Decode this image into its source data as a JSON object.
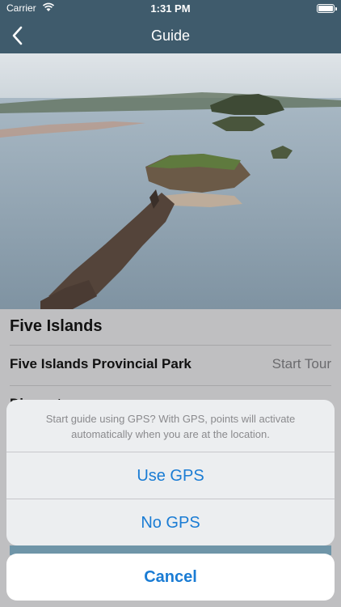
{
  "status_bar": {
    "carrier": "Carrier",
    "time": "1:31 PM"
  },
  "nav": {
    "title": "Guide",
    "back_icon": "chevron-left-icon"
  },
  "hero": {
    "alt_kind": "aerial-photo"
  },
  "list": {
    "place_title": "Five Islands",
    "park_name": "Five Islands Provincial Park",
    "start_tour": "Start Tour",
    "partial_row": "Dinner t"
  },
  "action_sheet": {
    "message": "Start guide using GPS? With GPS, points will activate automatically when you are at the location.",
    "use_gps": "Use GPS",
    "no_gps": "No GPS",
    "cancel": "Cancel"
  },
  "colors": {
    "nav_bg": "#3f5b6c",
    "action_blue": "#1a7cd4"
  }
}
